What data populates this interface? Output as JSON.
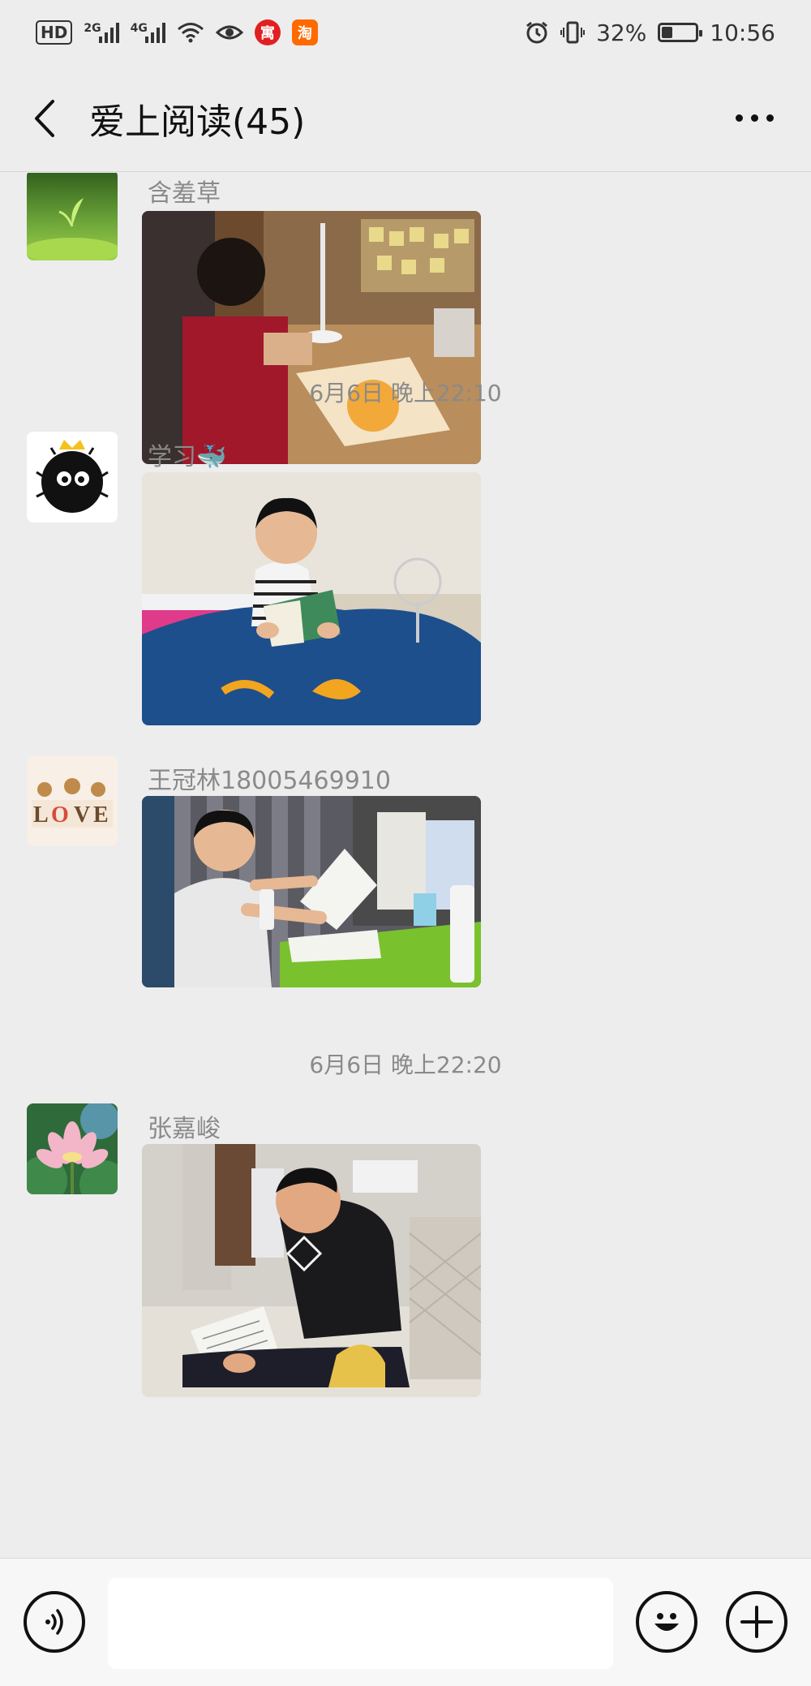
{
  "status_bar": {
    "hd_label": "HD",
    "net1_label": "2G",
    "net2_label": "4G",
    "battery_percent": "32%",
    "battery_level": 0.32,
    "time": "10:56",
    "app_icon_1": "寓",
    "app_icon_2": "淘"
  },
  "nav": {
    "title": "爱上阅读(45)",
    "back_icon": "chevron-left-icon",
    "more_icon": "ellipsis-icon"
  },
  "messages": [
    {
      "sender": "含羞草"
    },
    {
      "sender": "学习🐳"
    },
    {
      "sender": "王冠林18005469910"
    },
    {
      "sender": "张嘉峻"
    }
  ],
  "timestamps": [
    "6月6日 晚上22:10",
    "6月6日 晚上22:20"
  ],
  "input_bar": {
    "value": "",
    "voice_icon": "voice-icon",
    "emoji_icon": "emoji-icon",
    "plus_icon": "plus-icon"
  }
}
